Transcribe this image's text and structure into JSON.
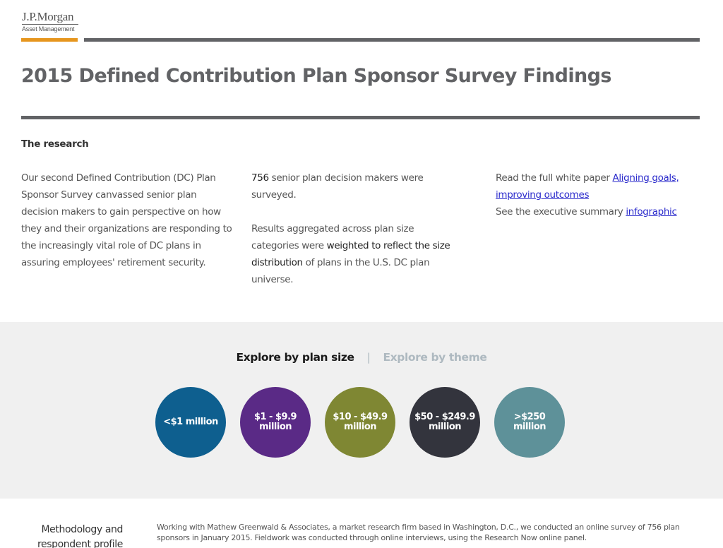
{
  "brand": {
    "name": "J.P.Morgan",
    "subtitle": "Asset Management",
    "accent_color": "#e6961e",
    "rule_color": "#626366"
  },
  "page": {
    "title": "2015 Defined Contribution Plan Sponsor Survey Findings"
  },
  "research": {
    "heading": "The research",
    "col1": {
      "text": "Our second Defined Contribution (DC) Plan Sponsor Survey canvassed senior plan decision makers to gain perspective on how they and their organizations are responding to the increasingly vital role of DC plans in assuring employees' retirement security."
    },
    "col2": {
      "p1_strong": "756",
      "p1_rest": " senior plan decision makers were surveyed.",
      "p2_pre": "Results aggregated across plan size categories were ",
      "p2_strong": "weighted to reflect the size distribution",
      "p2_post": " of plans in the U.S. DC plan universe."
    },
    "col3": {
      "line1_text": "Read the full white paper ",
      "line1_link": "Aligning goals, improving outcomes",
      "line2_text": "See the executive summary ",
      "line2_link": "infographic",
      "link_color": "#2b2bcc"
    }
  },
  "explore": {
    "tabs": [
      {
        "label": "Explore by plan size",
        "active": true
      },
      {
        "label": "Explore by theme",
        "active": false
      }
    ],
    "separator": "|",
    "plan_sizes": [
      {
        "line1": "<$1 million",
        "line2": "",
        "color": "#0e5f8f"
      },
      {
        "line1": "$1 - $9.9",
        "line2": "million",
        "color": "#5a2a86"
      },
      {
        "line1": "$10 - $49.9",
        "line2": "million",
        "color": "#7f8733"
      },
      {
        "line1": "$50 - $249.9",
        "line2": "million",
        "color": "#33343d"
      },
      {
        "line1": ">$250",
        "line2": "million",
        "color": "#5e9199"
      }
    ],
    "band_color": "#f0f0f0"
  },
  "methodology": {
    "label_line1": "Methodology and",
    "label_line2": "respondent profile",
    "text": "Working with Mathew Greenwald & Associates, a market research firm based in Washington, D.C., we conducted an online survey of 756 plan sponsors in January 2015. Fieldwork was conducted through online interviews, using the Research Now online panel."
  }
}
